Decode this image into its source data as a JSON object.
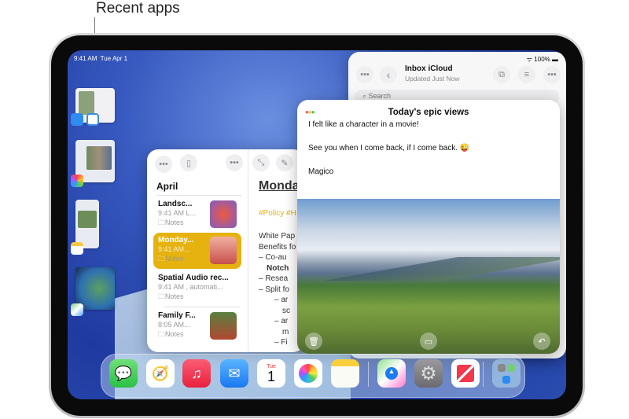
{
  "callout": {
    "label": "Recent apps"
  },
  "status_bar": {
    "time": "9:41 AM",
    "date": "Tue Apr 1",
    "battery": "100%"
  },
  "recent_apps": [
    {
      "name": "Mail + Files",
      "icons": [
        "mail-icon",
        "files-icon"
      ]
    },
    {
      "name": "Photos",
      "icons": [
        "photos-icon"
      ]
    },
    {
      "name": "Notes",
      "icons": [
        "notes-icon"
      ]
    },
    {
      "name": "Maps",
      "icons": [
        "maps-icon"
      ]
    }
  ],
  "notes": {
    "section": "April",
    "items": [
      {
        "title": "Landsc...",
        "meta": "9:41 AM  L...",
        "folder": "Notes",
        "selected": false
      },
      {
        "title": "Monday...",
        "meta": "9:41 AM...",
        "folder": "Notes",
        "selected": true
      },
      {
        "title": "Spatial Audio rec...",
        "meta": "9:41 AM  , automati...",
        "folder": "Notes",
        "selected": false
      },
      {
        "title": "Family F...",
        "meta": "8:05 AM...",
        "folder": "Notes",
        "selected": false
      }
    ],
    "doc_title": "Monda",
    "tags": "#Policy #H",
    "lines": [
      "White Pap",
      "Benefits fo",
      "–  Co-au",
      "    Notch",
      "–  Resea",
      "–  Split fo",
      "     –  ar",
      "         sc",
      "     –  ar",
      "         m",
      "     –  Fi"
    ],
    "accent": "#e5b20f"
  },
  "mail": {
    "title": "Inbox iCloud",
    "subtitle": "Updated Just Now",
    "search_placeholder": "Search"
  },
  "message": {
    "title": "Today's epic views",
    "lines": [
      "I felt like a character in a movie!",
      "See you when I come back, if I come back. 😜",
      "Magico"
    ]
  },
  "dock": {
    "apps": [
      "Messages",
      "Safari",
      "Music",
      "Mail",
      "Calendar",
      "Photos",
      "Notes",
      "Maps",
      "Settings",
      "News",
      "App Library"
    ],
    "calendar_day": "Tue",
    "calendar_date": "1"
  }
}
